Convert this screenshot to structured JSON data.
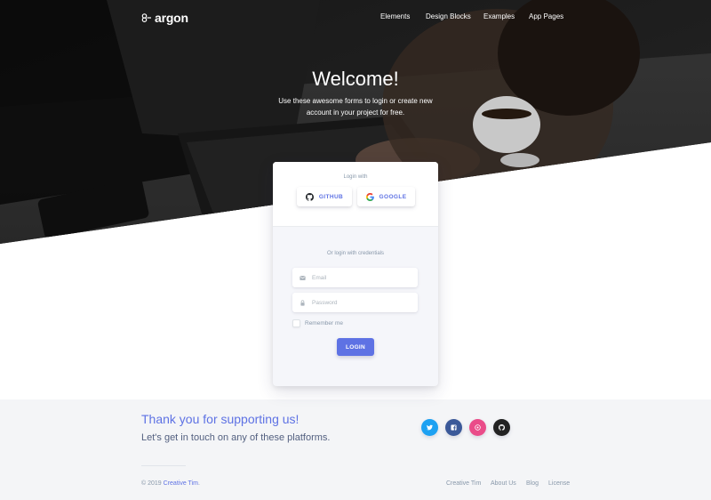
{
  "brand": {
    "name": "argon"
  },
  "nav": {
    "items": [
      {
        "label": "Elements"
      },
      {
        "label": "Design Blocks"
      },
      {
        "label": "Examples"
      },
      {
        "label": "App Pages"
      }
    ]
  },
  "hero": {
    "title": "Welcome!",
    "subtitle": "Use these awesome forms to login or create new account in your project for free."
  },
  "card": {
    "login_with": "Login with",
    "github_label": "GITHUB",
    "google_label": "GOOGLE",
    "credentials_label": "Or login with credentials",
    "email_placeholder": "Email",
    "password_placeholder": "Password",
    "remember_label": "Remember me",
    "remember_checked": false,
    "login_label": "LOGIN"
  },
  "footer": {
    "thanks": "Thank you for supporting us!",
    "touch": "Let's get in touch on any of these platforms.",
    "socials": [
      {
        "icon": "twitter-icon",
        "color": "#1da1f2"
      },
      {
        "icon": "facebook-icon",
        "color": "#3b5999"
      },
      {
        "icon": "dribbble-icon",
        "color": "#ea4c89"
      },
      {
        "icon": "github-icon",
        "color": "#222222"
      }
    ],
    "copyright_prefix": "© 2019",
    "copyright_link": "Creative Tim",
    "copyright_suffix": ".",
    "links": [
      {
        "label": "Creative Tim"
      },
      {
        "label": "About Us"
      },
      {
        "label": "Blog"
      },
      {
        "label": "License"
      }
    ]
  },
  "colors": {
    "primary": "#5e72e4",
    "text": "#525f7f",
    "muted": "#8898aa",
    "footer_bg": "#f4f5f7"
  }
}
